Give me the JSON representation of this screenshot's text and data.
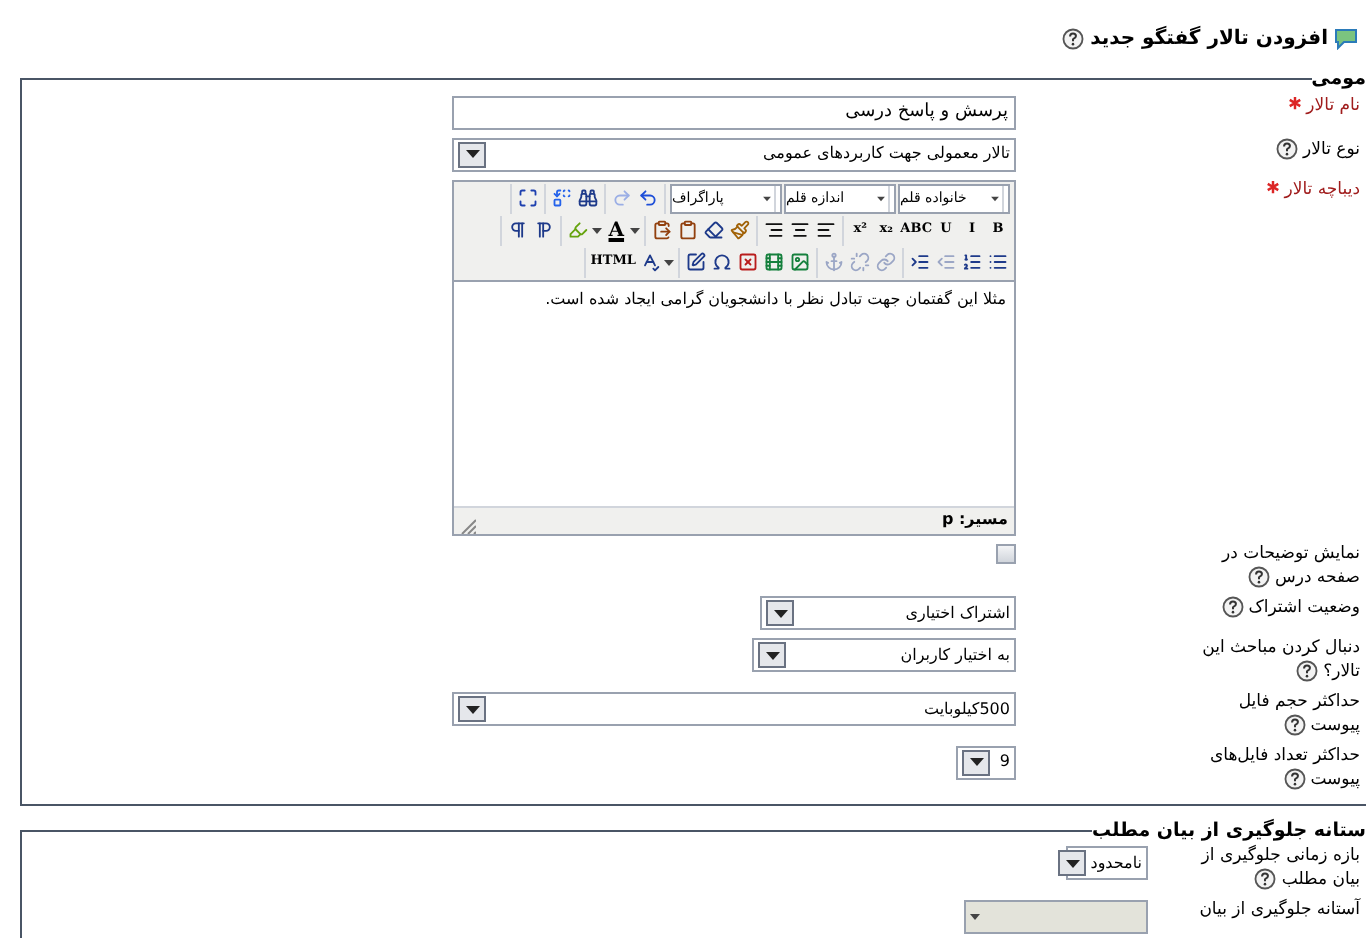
{
  "page_title": "افزودن تالار گفتگو جدید",
  "sections": [
    {
      "legend": "مومی",
      "fields": [
        {
          "kind": "text",
          "label": "نام تالار",
          "required": true,
          "help": false,
          "value": "پرسش و پاسخ درسی"
        },
        {
          "kind": "select",
          "label": "نوع تالار",
          "required": false,
          "help": true,
          "value": "تالار معمولی جهت کاربردهای عمومی",
          "disabled": false
        },
        {
          "kind": "editor",
          "label": "دیباچه تالار",
          "required": true,
          "help": false,
          "editor": {
            "toolbar": [
              [
                [
                  {
                    "kind": "select",
                    "label": "خانواده قلم"
                  },
                  {
                    "kind": "select",
                    "label": "اندازه قلم"
                  },
                  {
                    "kind": "select",
                    "label": "پاراگراف"
                  }
                ],
                [
                  {
                    "kind": "undo",
                    "disabled": false
                  },
                  {
                    "kind": "redo",
                    "disabled": true
                  }
                ],
                [
                  {
                    "kind": "find",
                    "disabled": false
                  },
                  {
                    "kind": "replace",
                    "disabled": false
                  }
                ],
                [
                  {
                    "kind": "fullscreen",
                    "disabled": false
                  }
                ]
              ],
              [
                [
                  {
                    "kind": "glyph",
                    "label": "B",
                    "disabled": false
                  },
                  {
                    "kind": "glyph",
                    "label": "I",
                    "disabled": false
                  },
                  {
                    "kind": "glyph",
                    "label": "U",
                    "disabled": false
                  },
                  {
                    "kind": "glyph",
                    "label": "ABC",
                    "disabled": false
                  },
                  {
                    "kind": "glyph",
                    "label": "x₂",
                    "disabled": false
                  },
                  {
                    "kind": "glyph",
                    "label": "x²",
                    "disabled": false
                  }
                ],
                [
                  {
                    "kind": "align-left",
                    "disabled": false
                  },
                  {
                    "kind": "align-center",
                    "disabled": false
                  },
                  {
                    "kind": "align-right",
                    "disabled": false
                  }
                ],
                [
                  {
                    "kind": "cleanup",
                    "disabled": false
                  },
                  {
                    "kind": "eraser",
                    "disabled": false
                  },
                  {
                    "kind": "paste-text",
                    "disabled": false
                  },
                  {
                    "kind": "paste-word",
                    "disabled": false
                  }
                ],
                [
                  {
                    "kind": "color",
                    "label": "A",
                    "disabled": false
                  },
                  {
                    "kind": "highlight",
                    "disabled": false
                  }
                ],
                [
                  {
                    "kind": "ltr",
                    "disabled": false
                  },
                  {
                    "kind": "rtl",
                    "disabled": false
                  }
                ]
              ],
              [
                [
                  {
                    "kind": "bullets",
                    "disabled": false
                  },
                  {
                    "kind": "numbers",
                    "disabled": false
                  },
                  {
                    "kind": "outdent",
                    "disabled": true
                  },
                  {
                    "kind": "indent",
                    "disabled": false
                  }
                ],
                [
                  {
                    "kind": "link",
                    "disabled": true
                  },
                  {
                    "kind": "unlink",
                    "disabled": true
                  },
                  {
                    "kind": "anchor",
                    "disabled": true
                  }
                ],
                [
                  {
                    "kind": "image",
                    "disabled": false
                  },
                  {
                    "kind": "media",
                    "disabled": false
                  },
                  {
                    "kind": "nolink",
                    "disabled": false
                  },
                  {
                    "kind": "omega",
                    "disabled": false
                  },
                  {
                    "kind": "edit",
                    "disabled": false
                  }
                ],
                [
                  {
                    "kind": "spellcheck",
                    "disabled": false
                  },
                  {
                    "kind": "glyph",
                    "label": "HTML",
                    "disabled": false
                  }
                ]
              ]
            ],
            "content": "مثلا این گفتمان جهت تبادل نظر با دانشجویان گرامی ایجاد شده است.",
            "path": "مسیر: p"
          }
        },
        {
          "kind": "checkbox",
          "label": "نمایش توضیحات در صفحه درس",
          "required": false,
          "help": true,
          "checked": false
        },
        {
          "kind": "select",
          "label": "وضعیت اشتراک",
          "required": false,
          "help": true,
          "value": "اشتراک اختیاری",
          "disabled": false
        },
        {
          "kind": "select",
          "label": "دنبال کردن مباحث این تالار؟",
          "required": false,
          "help": true,
          "value": "به اختیار کاربران",
          "disabled": false
        },
        {
          "kind": "select",
          "label": "حداکثر حجم فایل پیوست",
          "required": false,
          "help": true,
          "value": "500کیلوبایت",
          "disabled": false
        },
        {
          "kind": "select",
          "label": "حداکثر تعداد فایل‌های پیوست",
          "required": false,
          "help": true,
          "value": "9",
          "disabled": false
        }
      ]
    },
    {
      "legend": "ستانه جلوگیری از بیان مطلب",
      "fields": [
        {
          "kind": "select",
          "label": "بازه زمانی جلوگیری از بیان مطلب",
          "required": false,
          "help": true,
          "value": "نامحدود",
          "disabled": false
        },
        {
          "kind": "select",
          "label": "آستانه جلوگیری از بیان",
          "required": false,
          "help": false,
          "disabled": true
        }
      ]
    }
  ]
}
